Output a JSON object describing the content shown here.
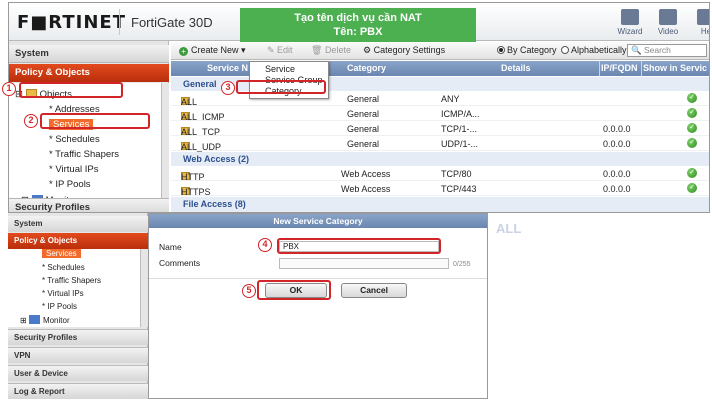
{
  "banner": {
    "line1": "Tạo tên dịch vụ cần NAT",
    "line2": "Tên: PBX"
  },
  "header": {
    "logo": "F■RTINET",
    "model": "FortiGate 30D",
    "tools": [
      {
        "label": "Wizard"
      },
      {
        "label": "Video"
      },
      {
        "label": "He"
      }
    ]
  },
  "sidebar_top": {
    "system": "System",
    "policy": "Policy & Objects",
    "objects": "Objects",
    "items": [
      "Addresses",
      "Services",
      "Schedules",
      "Traffic Shapers",
      "Virtual IPs",
      "IP Pools"
    ],
    "monitor": "Monitor",
    "security": "Security Profiles"
  },
  "toolbar": {
    "create_new": "Create New",
    "edit": "Edit",
    "delete": "Delete",
    "category_settings": "Category Settings",
    "by_category": "By Category",
    "alphabetically": "Alphabetically",
    "search_placeholder": "Search"
  },
  "dropdown": [
    "Service",
    "Service Group",
    "Category"
  ],
  "table": {
    "columns": [
      "Service N",
      "Category",
      "Details",
      "IP/FQDN",
      "Show in Servic"
    ],
    "groups": [
      {
        "name": "General",
        "rows": [
          {
            "name": "ALL",
            "category": "General",
            "details": "ANY",
            "ip": "",
            "show": true
          },
          {
            "name": "ALL_ICMP",
            "category": "General",
            "details": "ICMP/A...",
            "ip": "",
            "show": true
          },
          {
            "name": "ALL_TCP",
            "category": "General",
            "details": "TCP/1-...",
            "ip": "0.0.0.0",
            "show": true
          },
          {
            "name": "ALL_UDP",
            "category": "General",
            "details": "UDP/1-...",
            "ip": "0.0.0.0",
            "show": true
          }
        ]
      },
      {
        "name": "Web Access (2)",
        "rows": [
          {
            "name": "HTTP",
            "category": "Web Access",
            "details": "TCP/80",
            "ip": "0.0.0.0",
            "show": true
          },
          {
            "name": "HTTPS",
            "category": "Web Access",
            "details": "TCP/443",
            "ip": "0.0.0.0",
            "show": true
          }
        ]
      },
      {
        "name": "File Access (8)",
        "rows": []
      }
    ]
  },
  "sidebar_bottom": {
    "system": "System",
    "policy": "Policy & Objects",
    "items": [
      "Services",
      "Schedules",
      "Traffic Shapers",
      "Virtual IPs",
      "IP Pools"
    ],
    "monitor": "Monitor",
    "sections": [
      "Security Profiles",
      "VPN",
      "User & Device",
      "Log & Report"
    ]
  },
  "dialog": {
    "title": "New Service Category",
    "name_label": "Name",
    "name_value": "PBX",
    "comments_label": "Comments",
    "char_count": "0/255",
    "ok": "OK",
    "cancel": "Cancel"
  },
  "ghost_text": "ALL",
  "steps": [
    "1",
    "2",
    "3",
    "4",
    "5"
  ]
}
